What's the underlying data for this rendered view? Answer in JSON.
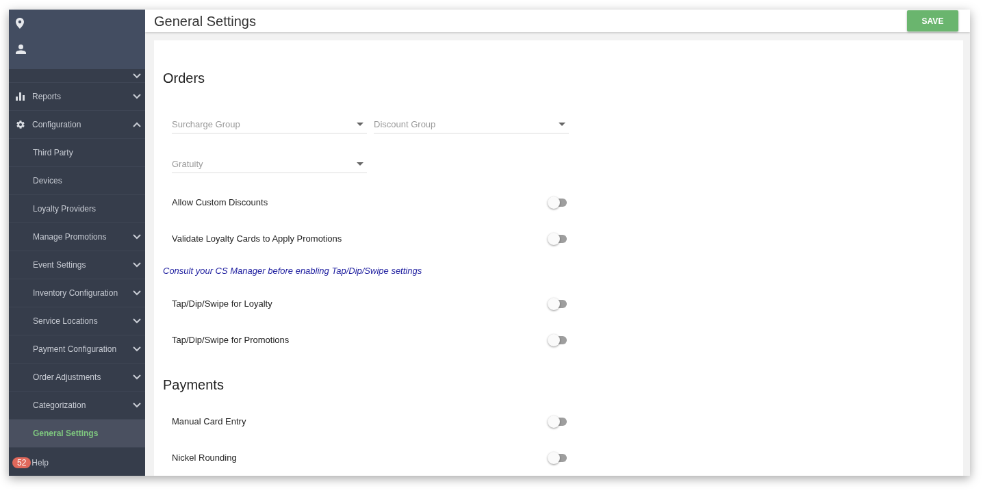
{
  "sidebar": {
    "items": [
      {
        "label": "Reports",
        "expandable": true,
        "expanded": false,
        "selected": false
      },
      {
        "label": "Configuration",
        "expandable": true,
        "expanded": true,
        "selected": false,
        "children": [
          {
            "label": "Third Party",
            "expandable": false,
            "selected": false
          },
          {
            "label": "Devices",
            "expandable": false,
            "selected": false
          },
          {
            "label": "Loyalty Providers",
            "expandable": false,
            "selected": false
          },
          {
            "label": "Manage Promotions",
            "expandable": true,
            "expanded": false,
            "selected": false
          },
          {
            "label": "Event Settings",
            "expandable": true,
            "expanded": false,
            "selected": false
          },
          {
            "label": "Inventory Configuration",
            "expandable": true,
            "expanded": false,
            "selected": false
          },
          {
            "label": "Service Locations",
            "expandable": true,
            "expanded": false,
            "selected": false
          },
          {
            "label": "Payment Configuration",
            "expandable": true,
            "expanded": false,
            "selected": false
          },
          {
            "label": "Order Adjustments",
            "expandable": true,
            "expanded": false,
            "selected": false
          },
          {
            "label": "Categorization",
            "expandable": true,
            "expanded": false,
            "selected": false
          },
          {
            "label": "General Settings",
            "expandable": false,
            "selected": true
          }
        ]
      }
    ],
    "help": {
      "badge": "52",
      "label": "Help"
    }
  },
  "header": {
    "title": "General Settings",
    "save_button": "SAVE"
  },
  "sections": [
    {
      "title": "Orders",
      "rows": [
        {
          "kind": "selects",
          "fields": [
            {
              "placeholder": "Surcharge Group"
            },
            {
              "placeholder": "Discount Group"
            }
          ]
        },
        {
          "kind": "selects",
          "fields": [
            {
              "placeholder": "Gratuity"
            }
          ]
        },
        {
          "kind": "toggle",
          "label": "Allow Custom Discounts",
          "on": false
        },
        {
          "kind": "toggle",
          "label": "Validate Loyalty Cards to Apply Promotions",
          "on": false
        },
        {
          "kind": "note",
          "text": "Consult your CS Manager before enabling Tap/Dip/Swipe settings"
        },
        {
          "kind": "toggle",
          "label": "Tap/Dip/Swipe for Loyalty",
          "on": false
        },
        {
          "kind": "toggle",
          "label": "Tap/Dip/Swipe for Promotions",
          "on": false
        }
      ]
    },
    {
      "title": "Payments",
      "rows": [
        {
          "kind": "toggle",
          "label": "Manual Card Entry",
          "on": false
        },
        {
          "kind": "toggle",
          "label": "Nickel Rounding",
          "on": false
        }
      ]
    }
  ]
}
